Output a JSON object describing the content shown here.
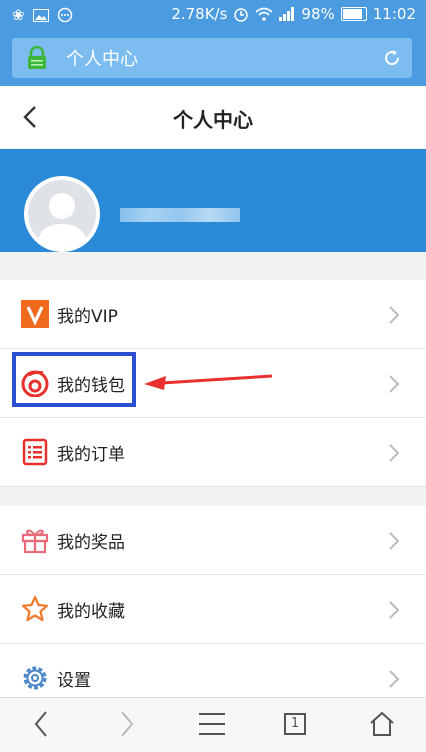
{
  "status_bar": {
    "network_speed": "2.78K/s",
    "battery": "98%",
    "time": "11:02"
  },
  "address_bar": {
    "title": "个人中心"
  },
  "header": {
    "title": "个人中心"
  },
  "menu_group_1": [
    {
      "label": "我的VIP",
      "icon": "vip-icon"
    },
    {
      "label": "我的钱包",
      "icon": "wallet-icon"
    },
    {
      "label": "我的订单",
      "icon": "order-icon"
    }
  ],
  "menu_group_2": [
    {
      "label": "我的奖品",
      "icon": "gift-icon"
    },
    {
      "label": "我的收藏",
      "icon": "star-icon"
    },
    {
      "label": "设置",
      "icon": "gear-icon"
    }
  ],
  "bottom_nav": {
    "tab_count": "1"
  },
  "colors": {
    "header_blue": "#4a9be0",
    "profile_blue": "#2a8ad8",
    "highlight": "#2c4fd0",
    "arrow": "#e8312d"
  }
}
